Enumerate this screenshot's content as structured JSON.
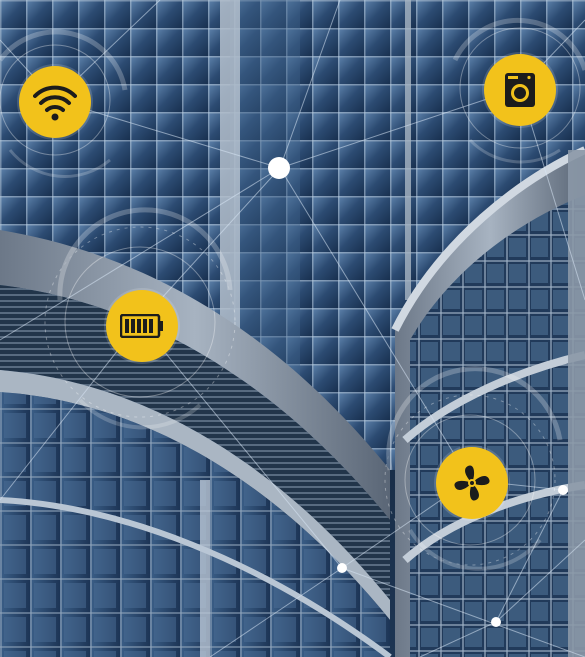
{
  "scene": {
    "description_free": true,
    "colors": {
      "sky_dark": "#0d1a2b",
      "glass_blue": "#2b4a70",
      "glass_light": "#7f9ec2",
      "concrete": "#9aa6b4",
      "accent_yellow": "#f2c21b",
      "icon_dark": "#1c1c1c",
      "network_line": "#d8e6f5"
    }
  },
  "icons": [
    {
      "name": "wifi-icon"
    },
    {
      "name": "washing-machine-icon"
    },
    {
      "name": "battery-icon"
    },
    {
      "name": "fan-icon"
    }
  ]
}
